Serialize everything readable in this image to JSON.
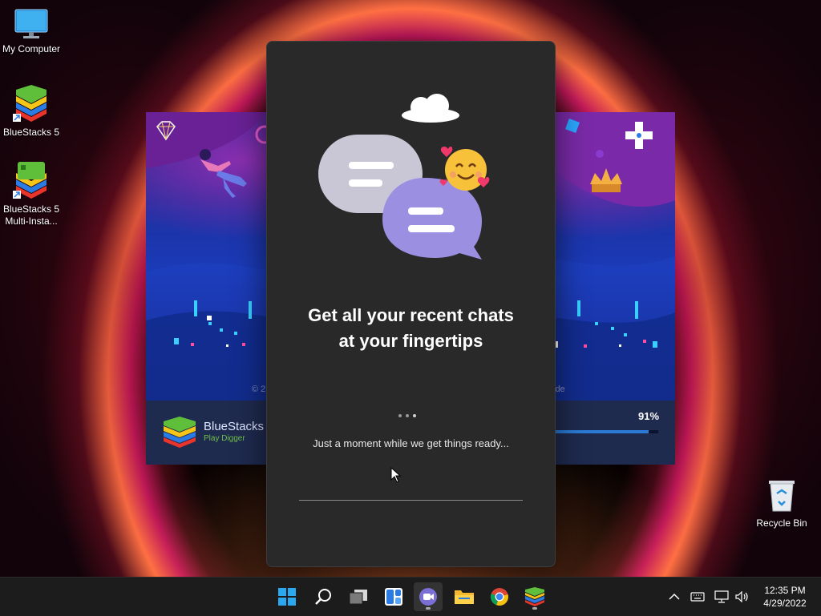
{
  "desktop": {
    "icons": [
      {
        "label": "My Computer"
      },
      {
        "label": "BlueStacks 5"
      },
      {
        "label": "BlueStacks 5 Multi-Insta..."
      }
    ],
    "recycle_bin": {
      "label": "Recycle Bin"
    }
  },
  "bluestacks_loader": {
    "brand": "BlueStacks",
    "tagline": "Play Digger",
    "copyright_fragment": "© 2",
    "copyright_fragment_right": "ide",
    "progress_text": "91%",
    "progress_value": 0.91
  },
  "teams_dialog": {
    "heading_line1": "Get all your recent chats",
    "heading_line2": "at your fingertips",
    "status": "Just a moment while we get things ready..."
  },
  "taskbar": {
    "apps": [
      "start-icon",
      "search-icon",
      "task-view-icon",
      "widgets-icon",
      "teams-chat-icon",
      "file-explorer-icon",
      "chrome-icon",
      "bluestacks-icon"
    ],
    "clock_time": "12:35 PM",
    "clock_date": "4/29/2022"
  },
  "colors": {
    "dialog_bg": "#292929",
    "taskbar_bg": "#1c1c1c",
    "progress_fill": "#2b7bd6",
    "chat_bubble_back": "#c9c6d6",
    "chat_bubble_front": "#9a8fe0"
  }
}
